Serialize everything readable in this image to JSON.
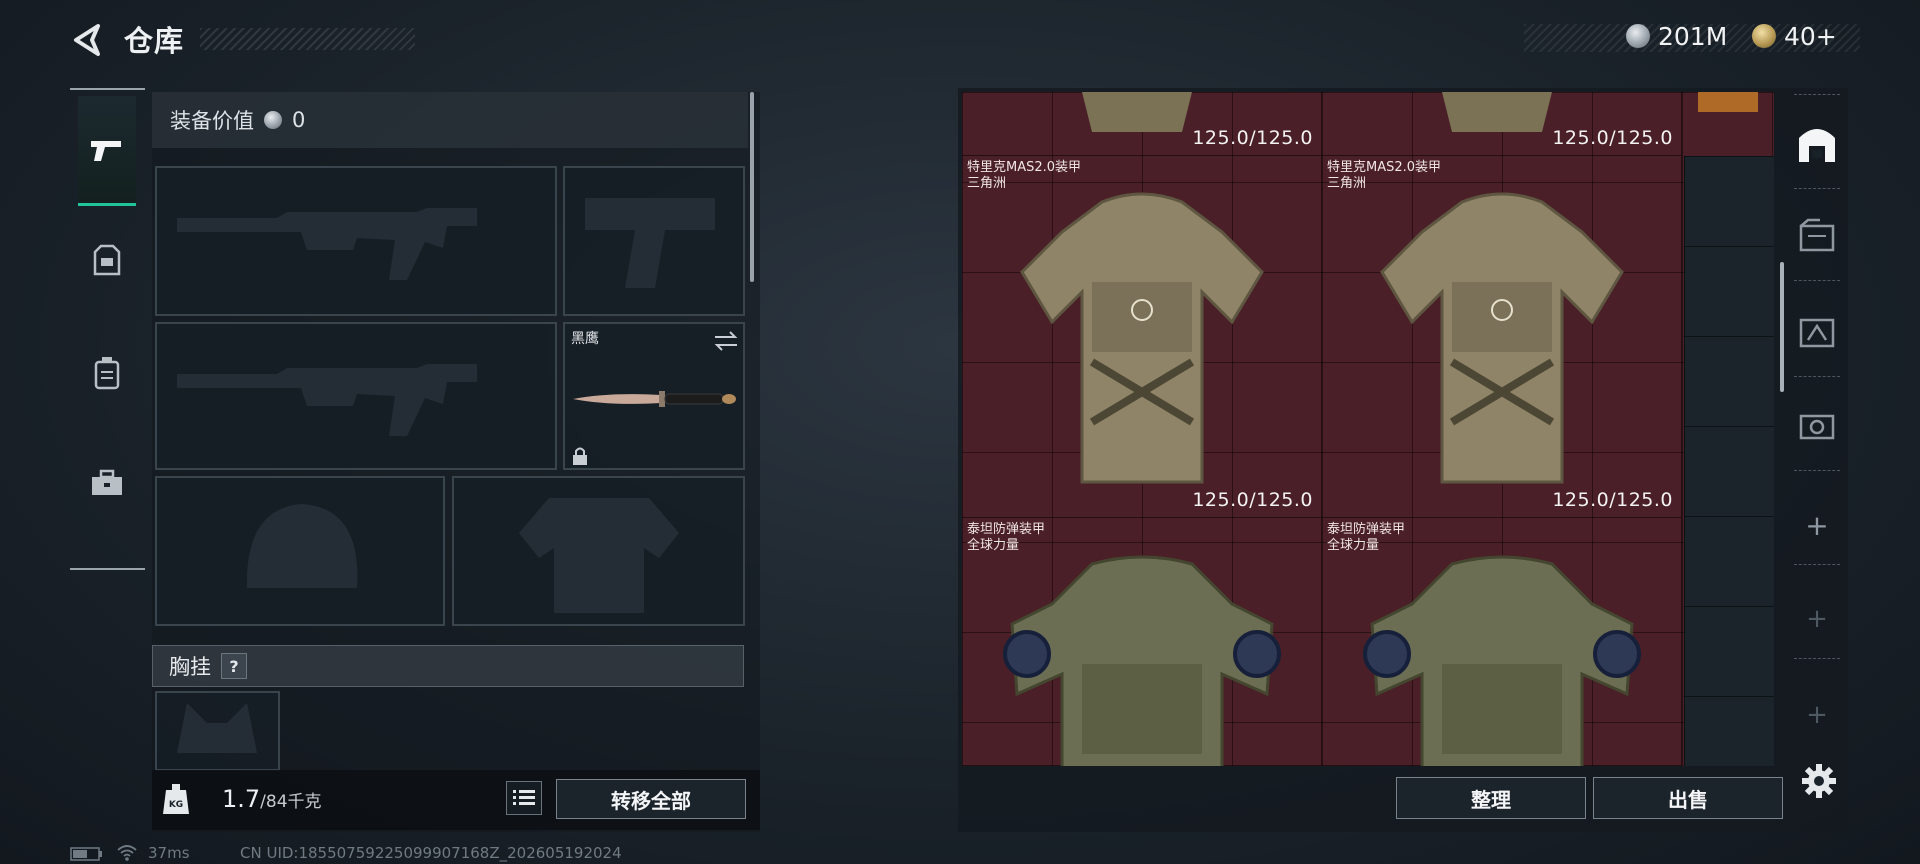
{
  "header": {
    "title": "仓库"
  },
  "currency": {
    "silver": "201M",
    "gold": "40+"
  },
  "left_tabs": [
    {
      "name": "weapons",
      "active": true
    },
    {
      "name": "armor",
      "active": false
    },
    {
      "name": "backpack",
      "active": false
    },
    {
      "name": "supplies",
      "active": false
    }
  ],
  "loadout": {
    "value_label": "装备价值",
    "value_amount": "0",
    "knife_label": "黑鹰",
    "chest_rig_label": "胸挂",
    "help_mark": "?",
    "weight_current": "1.7",
    "weight_max": "/84千克",
    "transfer_all": "转移全部"
  },
  "stash": {
    "durability_top_1": "125.0/125.0",
    "durability_top_2": "125.0/125.0",
    "items": [
      {
        "name_line1": "特里克MAS2.0装甲",
        "name_line2": "三角洲",
        "durability": "125.0/125.0",
        "color": "#8f8467"
      },
      {
        "name_line1": "特里克MAS2.0装甲",
        "name_line2": "三角洲",
        "durability": "125.0/125.0",
        "color": "#8f8467"
      },
      {
        "name_line1": "泰坦防弹装甲",
        "name_line2": "全球力量",
        "durability": "",
        "color": "#6b6e52"
      },
      {
        "name_line1": "泰坦防弹装甲",
        "name_line2": "全球力量",
        "durability": "",
        "color": "#6b6e52"
      }
    ],
    "organize_label": "整理",
    "sell_label": "出售"
  },
  "right_tabs": [
    "stash-main",
    "stash-2",
    "stash-3",
    "stash-4",
    "add",
    "add",
    "add"
  ],
  "status": {
    "ping": "37ms",
    "uid": "CN UID:18550759225099907168Z_202605192024"
  },
  "colors": {
    "accent": "#22c49c",
    "stash_bg": "#4a1f27"
  }
}
